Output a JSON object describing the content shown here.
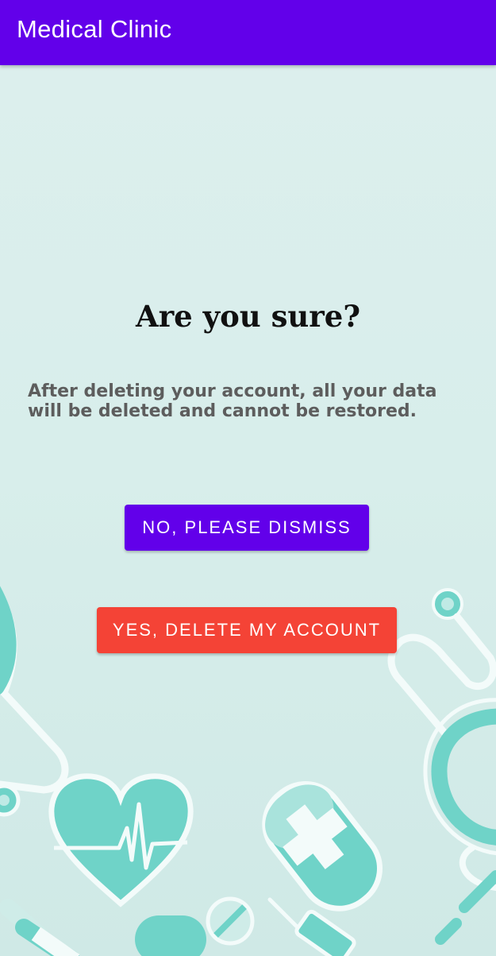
{
  "app_bar": {
    "title": "Medical Clinic",
    "color": "#6200ea"
  },
  "dialog": {
    "heading": "Are you sure?",
    "message": "After deleting your account, all your data will be deleted and cannot be restored."
  },
  "actions": {
    "dismiss_label": "NO, PLEASE DISMISS",
    "dismiss_color": "#6200ea",
    "delete_label": "YES, DELETE MY ACCOUNT",
    "delete_color": "#f44336"
  },
  "background": {
    "color": "#dcefed",
    "illustration_accent": "#6fd3c8",
    "illustrations": [
      "stethoscope-icon",
      "heart-ecg-icon",
      "medicine-bottle-icon",
      "pill-icon",
      "syringe-icon"
    ]
  }
}
